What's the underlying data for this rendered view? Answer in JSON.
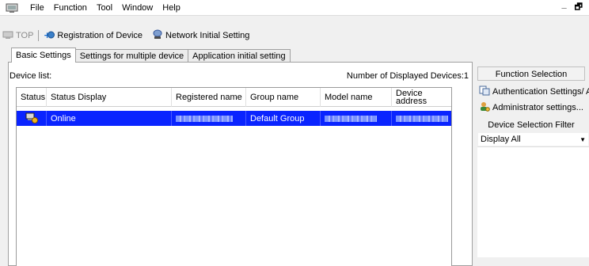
{
  "menubar": {
    "items": [
      "File",
      "Function",
      "Tool",
      "Window",
      "Help"
    ],
    "minimize": "_",
    "restore": "🗗"
  },
  "toolbar": {
    "top_label": "TOP",
    "registration_label": "Registration of Device",
    "network_label": "Network Initial Setting"
  },
  "tabs": [
    "Basic Settings",
    "Settings for multiple device",
    "Application initial setting"
  ],
  "device_list": {
    "label": "Device list:",
    "number_label": "Number of Displayed Devices:1",
    "columns": [
      "Status",
      "Status Display",
      "Registered name",
      "Group name",
      "Model name",
      "Device address"
    ],
    "rows": [
      {
        "status_display": "Online",
        "group_name": "Default Group"
      }
    ]
  },
  "right_panel": {
    "function_selection": "Function Selection",
    "auth_settings": "Authentication Settings/ Add",
    "admin_settings": "Administrator settings...",
    "filter_header": "Device Selection Filter",
    "filter_value": "Display All"
  },
  "colors": {
    "selection": "#0a24ff"
  }
}
